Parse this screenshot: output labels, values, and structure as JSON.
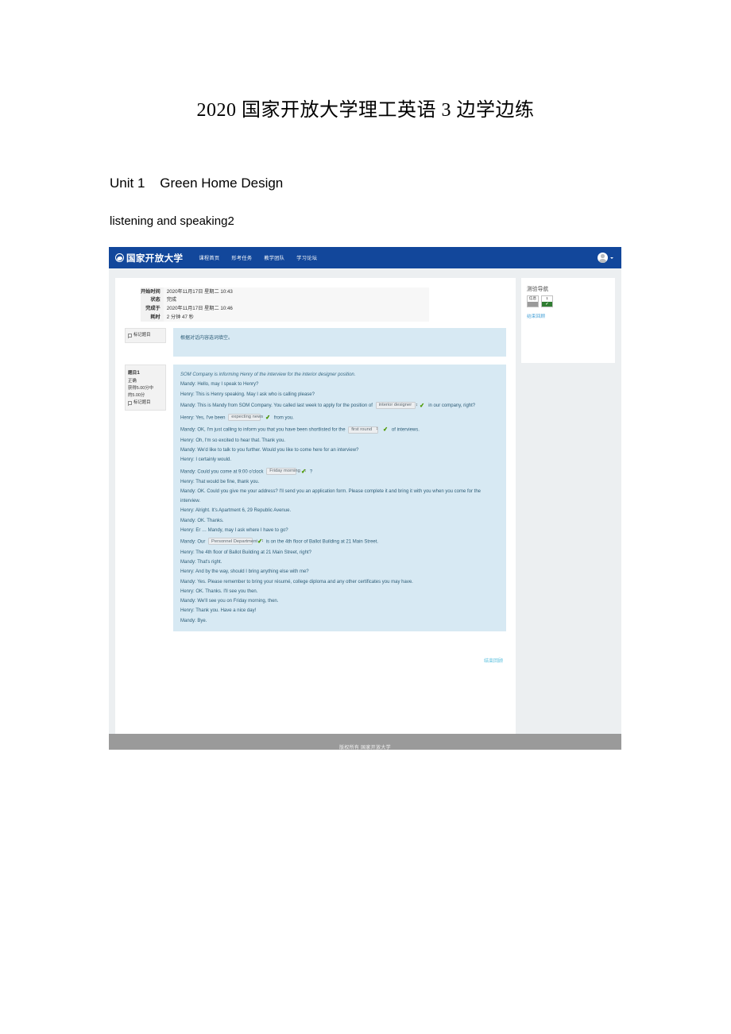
{
  "document": {
    "title": "2020 国家开放大学理工英语 3 边学边练",
    "heading_unit": "Unit 1    Green Home Design",
    "heading_section": "listening and speaking2"
  },
  "screenshot": {
    "navbar": {
      "logo_text": "国家开放大学",
      "menu": [
        {
          "label": "课程首页"
        },
        {
          "label": "形考任务"
        },
        {
          "label": "教学团队"
        },
        {
          "label": "学习论坛"
        }
      ]
    },
    "summary": {
      "rows": [
        {
          "label": "开始时间",
          "value": "2020年11月17日 星期二 10:43"
        },
        {
          "label": "状态",
          "value": "完成"
        },
        {
          "label": "完成于",
          "value": "2020年11月17日 星期二 10:46"
        },
        {
          "label": "耗时",
          "value": "2 分钟 47 秒"
        }
      ]
    },
    "prompt_block": {
      "flag_label": "标记题目",
      "text": "根据对话内容选词填空。"
    },
    "question": {
      "number_label": "题目",
      "number": "1",
      "status": "正确",
      "grade_line1": "获得5.00分中",
      "grade_line2": "的5.00分",
      "flag_label": "标记题目",
      "intro": "SOM Company is informing Henry of the interview for the interior designer position.",
      "lines": [
        {
          "id": "l1",
          "text": "Mandy: Hello, may I speak to Henry?"
        },
        {
          "id": "l2",
          "text": "Henry: This is Henry speaking. May I ask who is calling please?"
        },
        {
          "id": "l3",
          "pre": "Mandy: This is Mandy from SOM Company. You called last week to apply for the position of",
          "select": "interior designer",
          "post": "in our company, right?"
        },
        {
          "id": "l4",
          "pre": "Henry: Yes, I've been",
          "select": "expecting news",
          "post": "from you."
        },
        {
          "id": "l5",
          "pre": "Mandy: OK, I'm just calling to inform you that you have been shortlisted for the",
          "select": "first round",
          "post": "of interviews."
        },
        {
          "id": "l6",
          "text": "Henry: Oh, I'm so excited to hear that. Thank you."
        },
        {
          "id": "l7",
          "text": "Mandy: We'd like to talk to you further. Would you like to come here for an interview?"
        },
        {
          "id": "l8",
          "text": "Henry: I certainly would."
        },
        {
          "id": "l9",
          "pre": "Mandy: Could you come at 9:00 o'clock",
          "select": "Friday morning",
          "post": "?"
        },
        {
          "id": "l10",
          "text": "Henry: That would be fine, thank you."
        },
        {
          "id": "l11",
          "text": "Mandy: OK. Could you give me your address? I'll send you an application form. Please complete it and bring it with you when you come for the interview."
        },
        {
          "id": "l12",
          "text": "Henry: Alright. It's Apartment 6, 29 Republic Avenue."
        },
        {
          "id": "l13",
          "text": "Mandy: OK. Thanks."
        },
        {
          "id": "l14",
          "text": "Henry: Er … Mandy, may I ask where I have to go?"
        },
        {
          "id": "l15",
          "pre": "Mandy: Our",
          "select": "Personnel Department",
          "post": "is on the 4th floor of Ballot Building at 21 Main Street."
        },
        {
          "id": "l16",
          "text": "Henry: The 4th floor of Ballot Building at 21 Main Street, right?"
        },
        {
          "id": "l17",
          "text": "Mandy: That's right."
        },
        {
          "id": "l18",
          "text": "Henry: And by the way, should I bring anything else with me?"
        },
        {
          "id": "l19",
          "text": "Mandy: Yes. Please remember to bring your résumé, college diploma and any other certificates you may have."
        },
        {
          "id": "l20",
          "text": "Henry: OK. Thanks. I'll see you then."
        },
        {
          "id": "l21",
          "text": "Mandy: We'll see you on Friday morning, then."
        },
        {
          "id": "l22",
          "text": "Henry: Thank you. Have a nice day!"
        },
        {
          "id": "l23",
          "text": "Mandy: Bye."
        }
      ]
    },
    "finish_review_link": "结束回顾",
    "sidebar": {
      "title": "测验导航",
      "buttons": [
        {
          "label": "信息",
          "state": "info"
        },
        {
          "label": "1",
          "state": "correct"
        }
      ],
      "finish_link": "结束回顾"
    },
    "footer": {
      "text": "版权所有 国家开放大学"
    },
    "colors": {
      "navbar_blue": "#12479b",
      "question_bg": "#d7e9f3",
      "correct_green": "#2f7d32",
      "tick_green": "#4e9a06",
      "link_blue": "#5bc0de",
      "footer_gray": "#9a9a9a"
    }
  }
}
